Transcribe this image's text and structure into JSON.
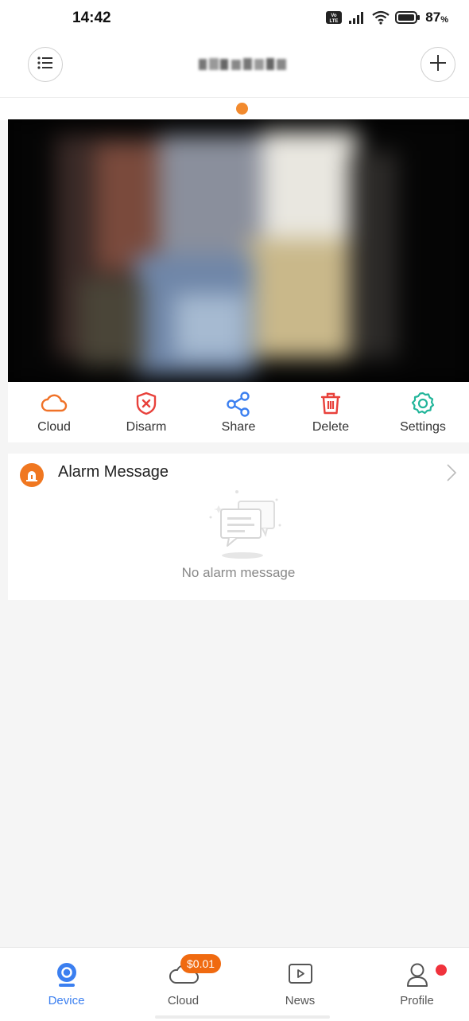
{
  "status_bar": {
    "time": "14:42",
    "battery": "87"
  },
  "header": {
    "title": "·388·5·769"
  },
  "actions": [
    {
      "label": "Cloud",
      "icon": "cloud-icon",
      "color": "#f07228"
    },
    {
      "label": "Disarm",
      "icon": "shield-x-icon",
      "color": "#e8413b"
    },
    {
      "label": "Share",
      "icon": "share-icon",
      "color": "#3b7ff0"
    },
    {
      "label": "Delete",
      "icon": "trash-icon",
      "color": "#e8413b"
    },
    {
      "label": "Settings",
      "icon": "gear-icon",
      "color": "#22b59a"
    }
  ],
  "alarm": {
    "title": "Alarm Message",
    "empty_text": "No alarm message"
  },
  "nav": [
    {
      "label": "Device",
      "icon": "camera-icon",
      "active": true
    },
    {
      "label": "Cloud",
      "icon": "cloud-icon",
      "badge": "$0.01"
    },
    {
      "label": "News",
      "icon": "play-icon"
    },
    {
      "label": "Profile",
      "icon": "person-icon"
    }
  ],
  "colors": {
    "accent": "#3b7ff0",
    "orange": "#f07228",
    "badge": "#f06a10",
    "notification": "#f0323c"
  }
}
